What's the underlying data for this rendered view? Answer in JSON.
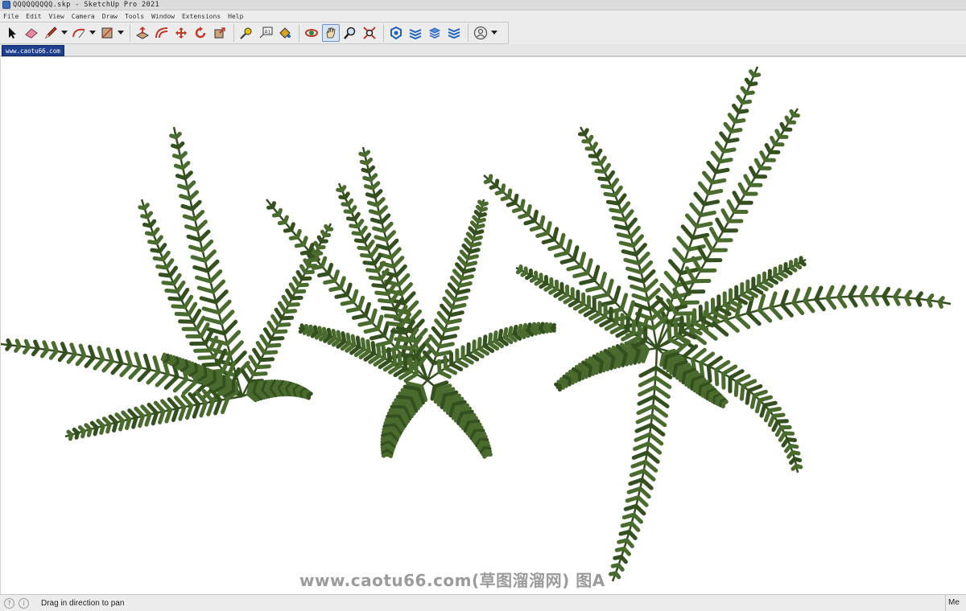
{
  "window": {
    "title": "QQQQQQQQQ.skp - SketchUp Pro 2021"
  },
  "menu": [
    "File",
    "Edit",
    "View",
    "Camera",
    "Draw",
    "Tools",
    "Window",
    "Extensions",
    "Help"
  ],
  "toolbar": {
    "tools": [
      {
        "icon": "select-arrow-icon"
      },
      {
        "icon": "eraser-icon"
      },
      {
        "icon": "pencil-line-icon"
      },
      {
        "icon": "arc-icon"
      },
      {
        "icon": "rectangle-shape-icon"
      },
      {
        "icon": "push-pull-icon"
      },
      {
        "icon": "offset-icon"
      },
      {
        "icon": "move-icon"
      },
      {
        "icon": "rotate-icon"
      },
      {
        "icon": "scale-icon"
      },
      {
        "icon": "tape-measure-icon"
      },
      {
        "icon": "text-label-icon"
      },
      {
        "icon": "paint-bucket-icon"
      },
      {
        "icon": "orbit-icon"
      },
      {
        "icon": "pan-hand-icon"
      },
      {
        "icon": "zoom-icon"
      },
      {
        "icon": "zoom-extents-icon"
      },
      {
        "icon": "warehouse-icon"
      },
      {
        "icon": "extension-warehouse-icon"
      },
      {
        "icon": "layout-send-icon"
      },
      {
        "icon": "extension-manager-icon"
      },
      {
        "icon": "account-icon"
      }
    ],
    "active_tool": "pan-hand-icon"
  },
  "scene_tab": {
    "label": "www.caotu66.com"
  },
  "viewport": {
    "background": "#ffffff",
    "foliage_color": "#4a6b2e",
    "foliage_dark": "#34501f"
  },
  "watermark": {
    "text": "www.caotu66.com(草图溜溜网) 图A"
  },
  "status": {
    "message": "Drag in direction to pan",
    "measurements_label": "Me"
  }
}
